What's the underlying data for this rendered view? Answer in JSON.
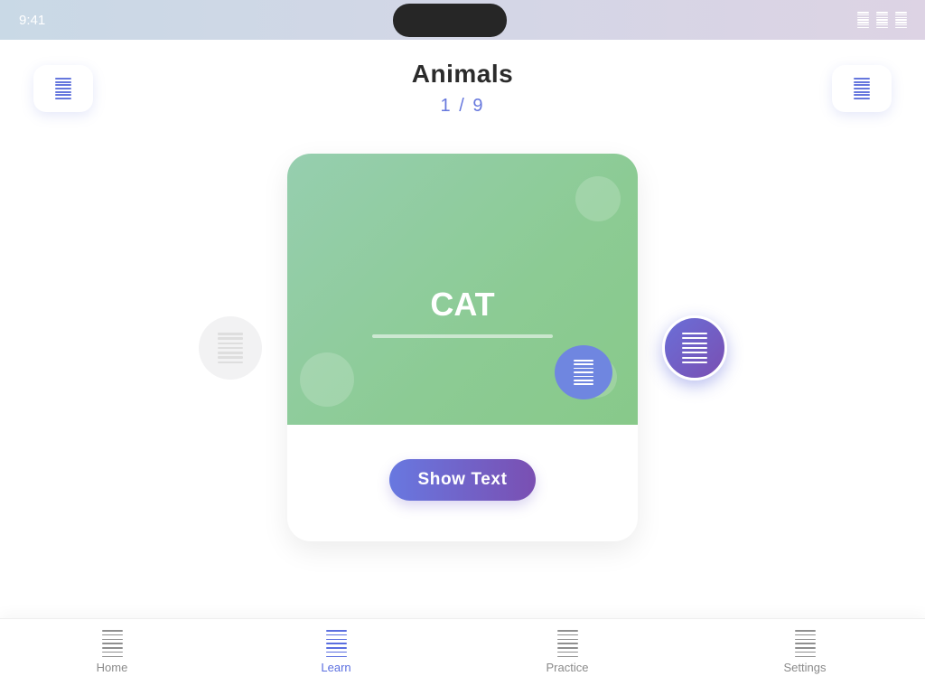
{
  "status_bar": {
    "time": "9:41",
    "icons": [
      "signal-icon",
      "wifi-icon",
      "battery-icon"
    ]
  },
  "header": {
    "title": "Animals",
    "progress": "1 / 9",
    "left_button_icon": "menu-icon",
    "right_button_icon": "menu-icon"
  },
  "card": {
    "word": "CAT",
    "show_text_label": "Show Text",
    "audio_icon": "speaker-icon",
    "image_color": "#8ccb94"
  },
  "navigation": {
    "prev_icon": "chevron-left-icon",
    "next_icon": "chevron-right-icon"
  },
  "tab_bar": {
    "tabs": [
      {
        "label": "Home",
        "icon": "home-icon",
        "active": false
      },
      {
        "label": "Learn",
        "icon": "book-icon",
        "active": true
      },
      {
        "label": "Practice",
        "icon": "practice-icon",
        "active": false
      },
      {
        "label": "Settings",
        "icon": "gear-icon",
        "active": false
      }
    ]
  },
  "colors": {
    "accent": "#5b6fe0",
    "accent_purple": "#7a4fb2",
    "card_green": "#8ccb94"
  }
}
